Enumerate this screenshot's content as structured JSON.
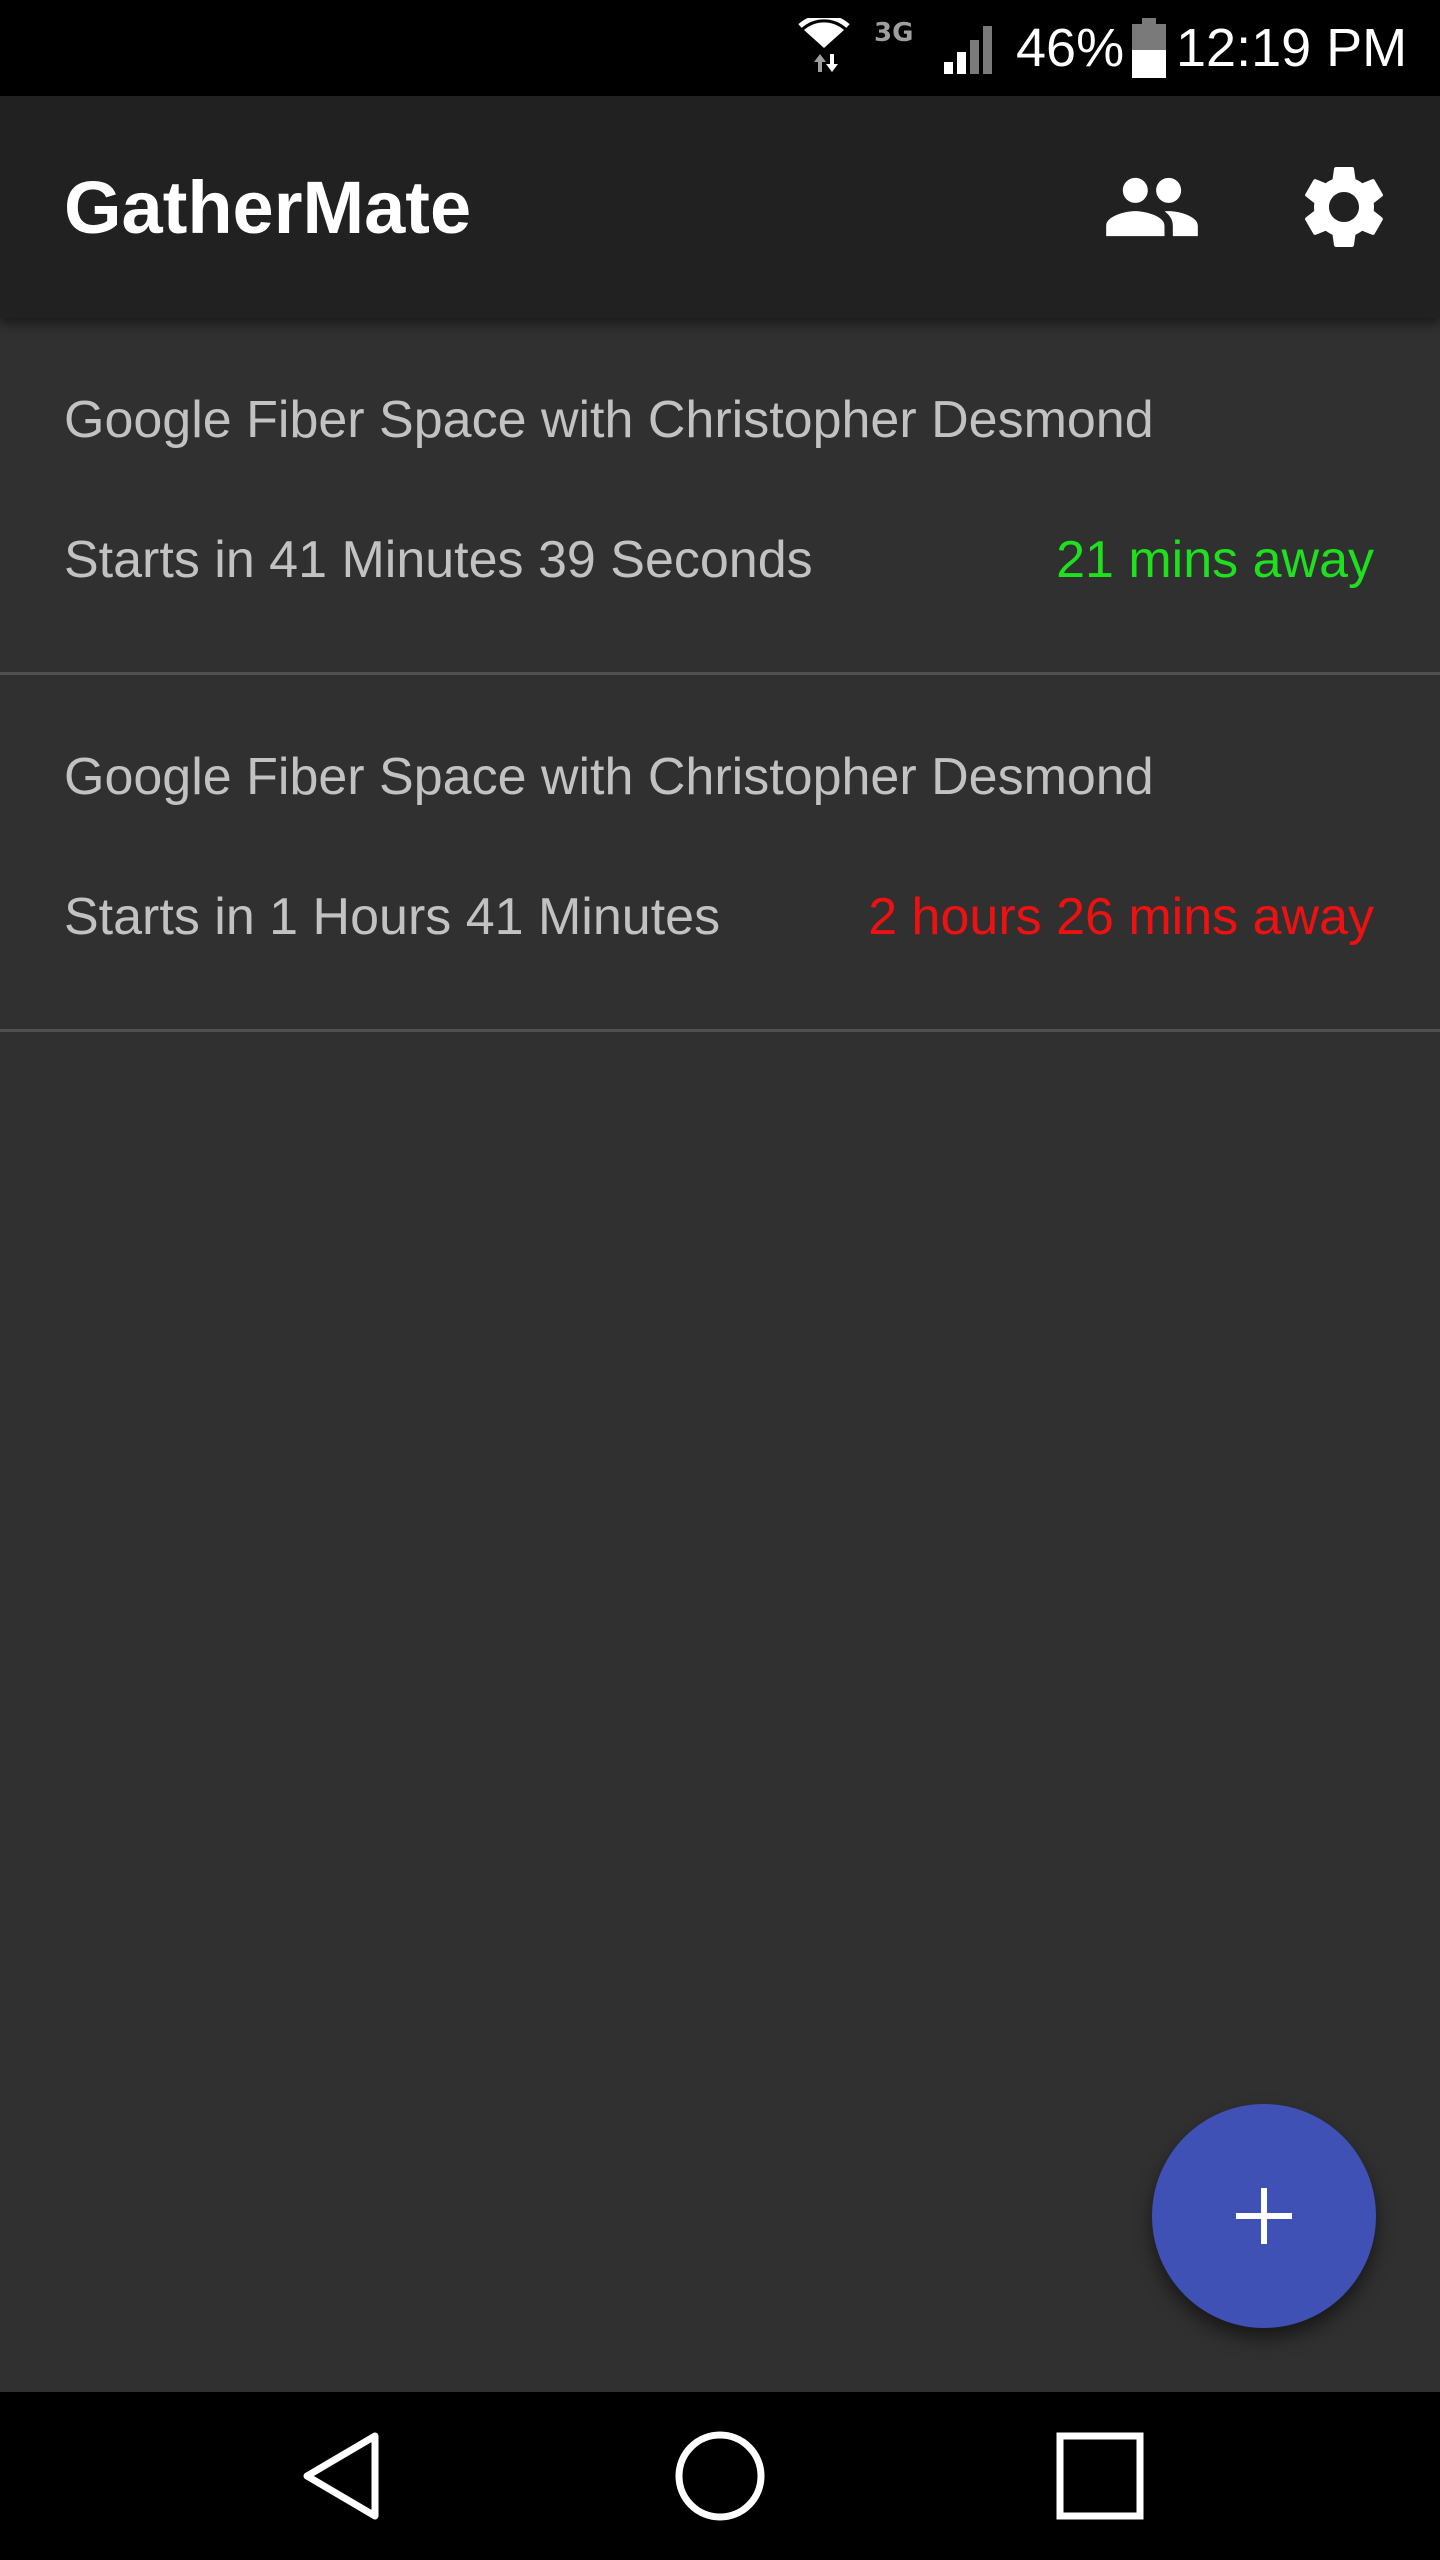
{
  "status_bar": {
    "network_type": "3G",
    "battery_percent": "46%",
    "time": "12:19 PM",
    "icons": [
      "wifi-icon",
      "signal-icon",
      "battery-icon"
    ]
  },
  "app_bar": {
    "title": "GatherMate",
    "actions": [
      "people-icon",
      "settings-gear-icon"
    ]
  },
  "events": [
    {
      "title": "Google Fiber Space with Christopher Desmond",
      "starts": "Starts in 41 Minutes 39 Seconds",
      "away": "21 mins away",
      "away_color": "#1ee01e"
    },
    {
      "title": "Google Fiber Space with Christopher Desmond",
      "starts": "Starts in 1 Hours 41 Minutes",
      "away": "2 hours 26 mins away",
      "away_color": "#ee1111"
    }
  ],
  "fab": {
    "icon": "plus-icon",
    "color": "#3f51b5"
  },
  "nav_bar": {
    "buttons": [
      "back-icon",
      "home-icon",
      "recents-icon"
    ]
  },
  "colors": {
    "background": "#303030",
    "app_bar": "#212121",
    "text_secondary": "#c2c2c2"
  }
}
